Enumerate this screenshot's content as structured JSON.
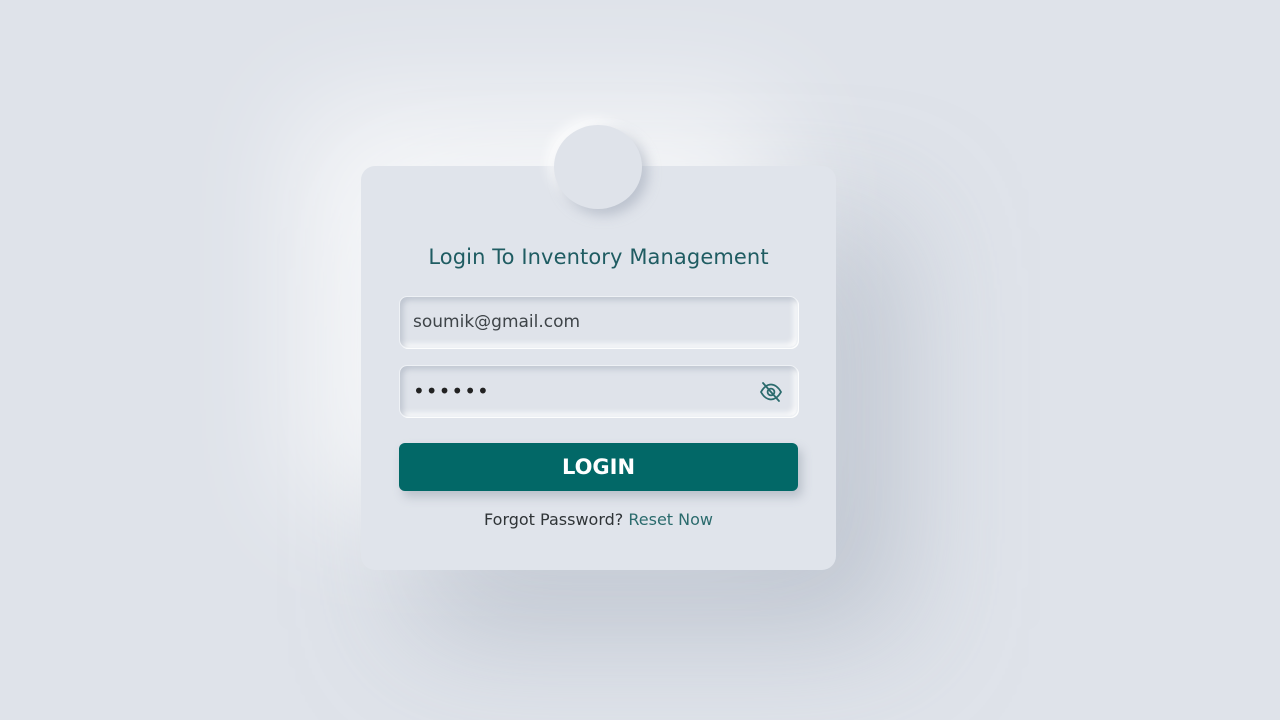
{
  "login": {
    "title": "Login To Inventory Management",
    "email": {
      "value": "soumik@gmail.com"
    },
    "password": {
      "masked_value": "••••••",
      "visibility_icon": "eye-slash-icon"
    },
    "submit_label": "LOGIN",
    "forgot_text": "Forgot Password?",
    "reset_link": "Reset Now"
  },
  "colors": {
    "background": "#dfe3ea",
    "accent": "#026867",
    "title": "#1f5c62",
    "link": "#2b6b6d"
  }
}
